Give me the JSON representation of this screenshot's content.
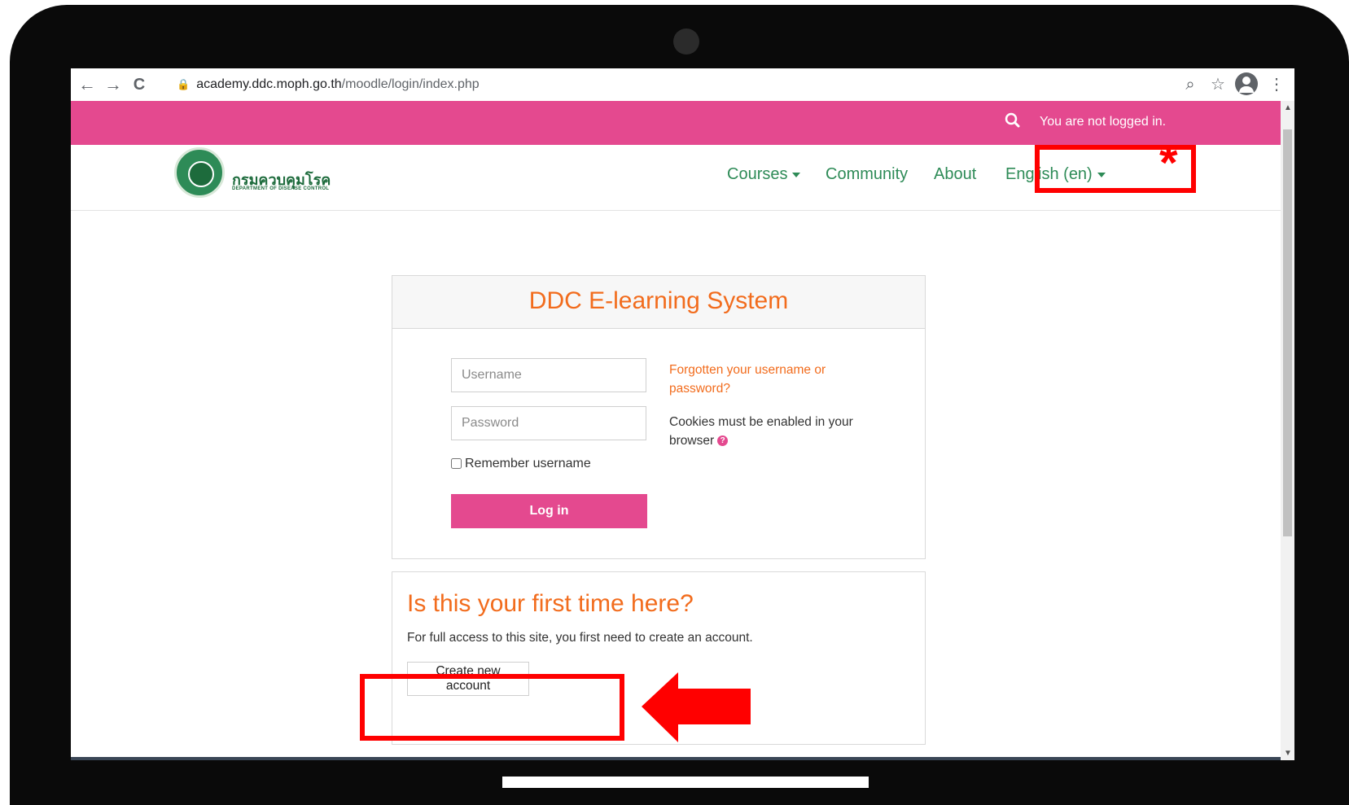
{
  "browser": {
    "url_domain": "academy.ddc.moph.go.th",
    "url_path": "/moodle/login/index.php",
    "back_icon": "←",
    "forward_icon": "→",
    "reload_icon": "C",
    "zoom_icon": "⌕",
    "star_icon": "☆",
    "menu_icon": "⋮"
  },
  "topbar": {
    "status": "You are not logged in.",
    "color": "#e4498f"
  },
  "navbar": {
    "logo_text": "กรมควบคุมโรค",
    "logo_subtext": "DEPARTMENT OF DISEASE CONTROL",
    "items": [
      {
        "label": "Courses"
      },
      {
        "label": "Community"
      },
      {
        "label": "About"
      },
      {
        "label": "English (en)"
      }
    ]
  },
  "login": {
    "title": "DDC E-learning System",
    "username_placeholder": "Username",
    "password_placeholder": "Password",
    "remember_label": "Remember username",
    "remember_checked": false,
    "login_button": "Log in",
    "forgot_link": "Forgotten your username or password?",
    "cookies_notice": "Cookies must be enabled in your browser",
    "help_icon": "?"
  },
  "signup": {
    "title": "Is this your first time here?",
    "description": "For full access to this site, you first need to create an account.",
    "create_button": "Create new account"
  },
  "annotations": {
    "star": "*",
    "color": "#ff0000"
  },
  "accent_color": "#f26c1d",
  "nav_color": "#2e8b57"
}
